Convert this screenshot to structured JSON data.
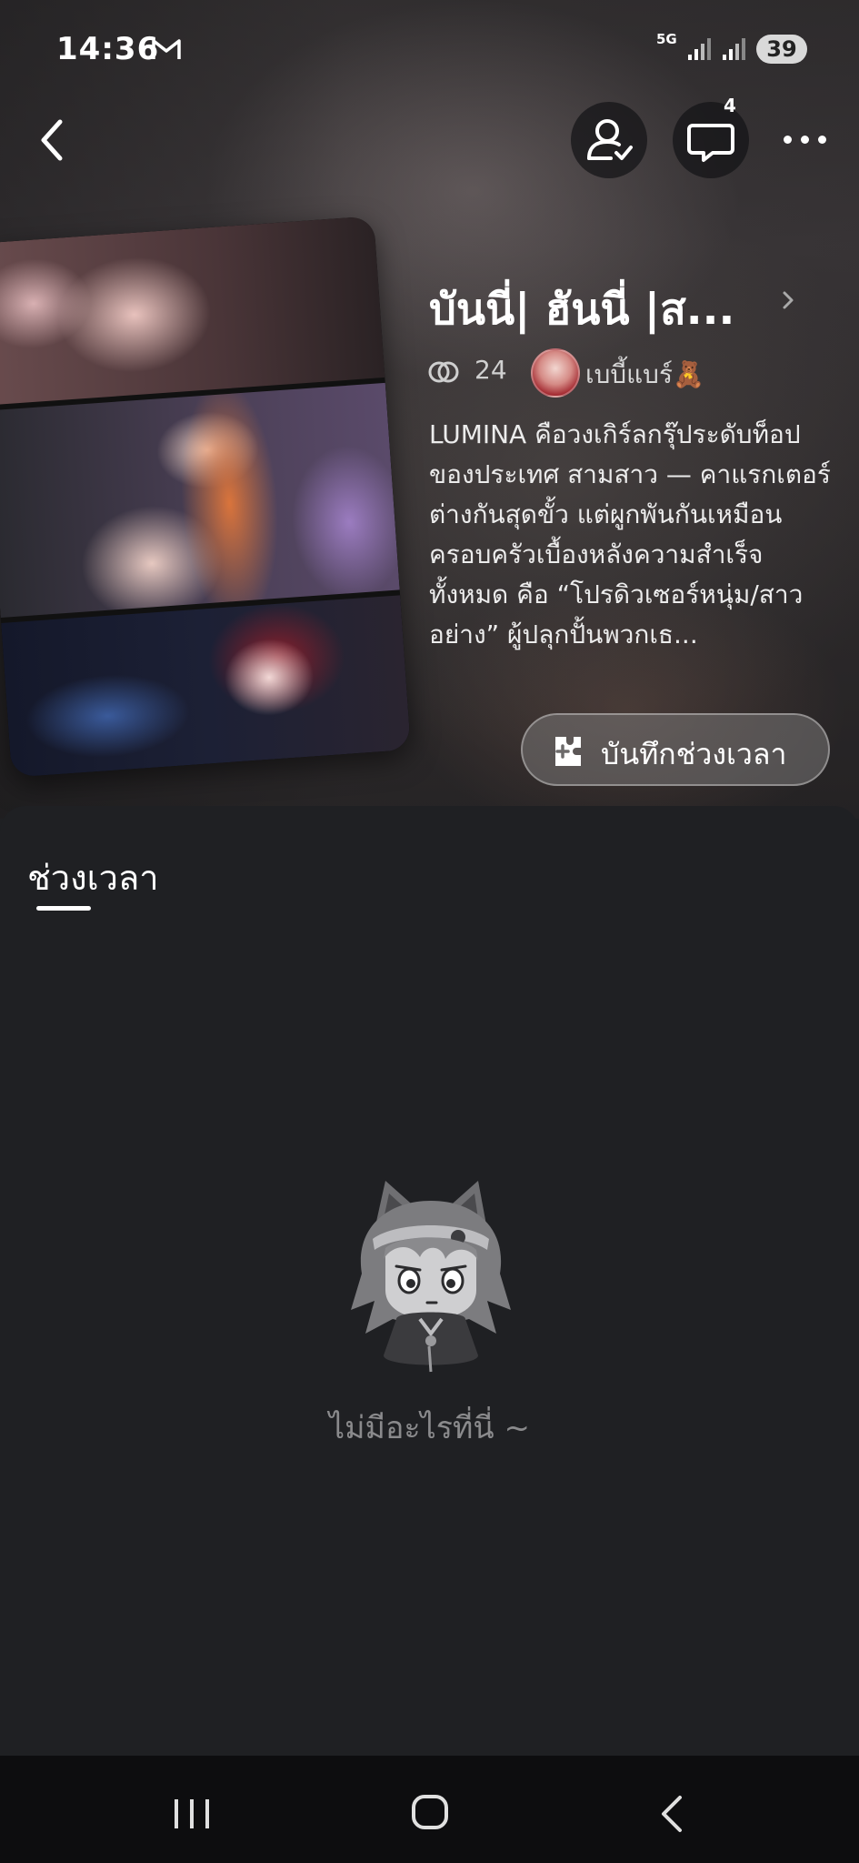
{
  "status_bar": {
    "time": "14:36",
    "network": "5G",
    "battery": "39"
  },
  "header": {
    "chat_badge": "4"
  },
  "story": {
    "title": "บันนี่| ฮันนี่ |ส...",
    "like_count": "24",
    "author_name": "เบบี้แบร์🧸",
    "description": "LUMINA คือวงเกิร์ลกรุ๊ประดับท็อปของประเทศ สามสาว — คาแรกเตอร์ต่างกันสุดขั้ว แต่ผูกพันกันเหมือนครอบครัวเบื้องหลังความสำเร็จทั้งหมด คือ “โปรดิวเซอร์หนุ่ม/สาวอย่าง” ผู้ปลุกปั้นพวกเธ...",
    "record_button": "บันทึกช่วงเวลา"
  },
  "tabs": [
    {
      "label": "ช่วงเวลา",
      "active": true
    }
  ],
  "empty_state": {
    "text": "ไม่มีอะไรที่นี่ ~"
  },
  "icons": {
    "back": "chevron-left-icon",
    "follow": "user-check-icon",
    "chat": "chat-bubble-icon",
    "more": "more-dots-icon",
    "like": "link-rings-icon",
    "record": "puzzle-plus-icon"
  },
  "colors": {
    "sheet_background": "#1f2023",
    "nav_background": "#0d0d0f",
    "muted_text": "#8a8a8c"
  }
}
